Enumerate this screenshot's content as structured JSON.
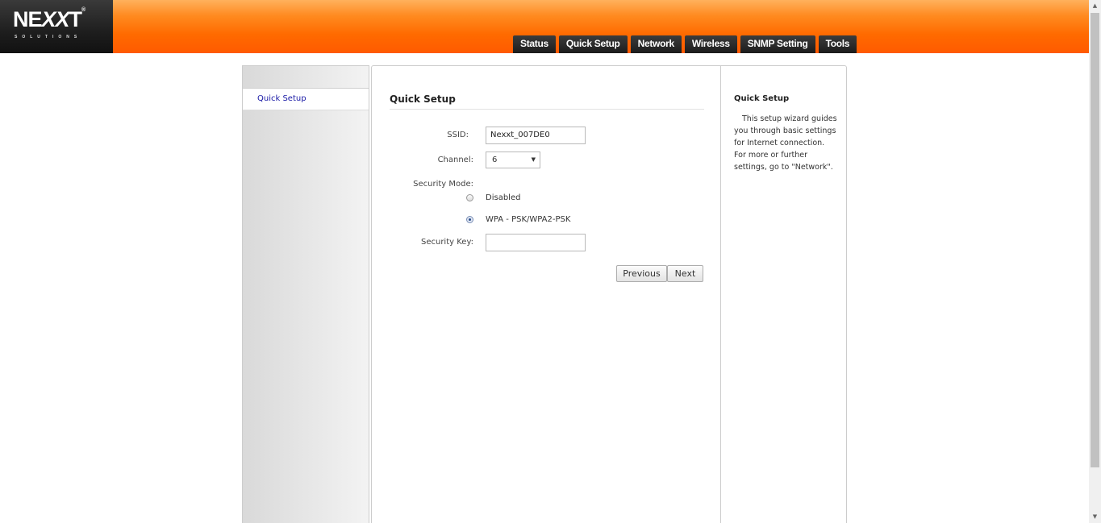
{
  "logo": {
    "brand_prefix": "NE",
    "brand_x": "XX",
    "brand_suffix": "T",
    "trademark": "®",
    "tagline": "SOLUTIONS"
  },
  "nav": {
    "tabs": [
      "Status",
      "Quick Setup",
      "Network",
      "Wireless",
      "SNMP Setting",
      "Tools"
    ]
  },
  "sidebar": {
    "items": [
      {
        "label": "Quick Setup"
      }
    ]
  },
  "content": {
    "title": "Quick Setup",
    "ssid": {
      "label": "SSID:",
      "value": "Nexxt_007DE0"
    },
    "channel": {
      "label": "Channel:",
      "selected": "6"
    },
    "security_mode": {
      "label": "Security Mode:",
      "options": [
        {
          "label": "Disabled",
          "checked": false
        },
        {
          "label": "WPA - PSK/WPA2-PSK",
          "checked": true
        }
      ]
    },
    "security_key": {
      "label": "Security Key:",
      "value": ""
    },
    "buttons": {
      "previous": "Previous",
      "next": "Next"
    }
  },
  "help": {
    "title": "Quick Setup",
    "text": "This setup wizard guides you through basic settings for Internet connection. For more or further settings, go to \"Network\"."
  },
  "colors": {
    "header_orange": "#ff6a00",
    "tab_dark": "#2a2a2a",
    "link_blue": "#1a1aa6"
  }
}
